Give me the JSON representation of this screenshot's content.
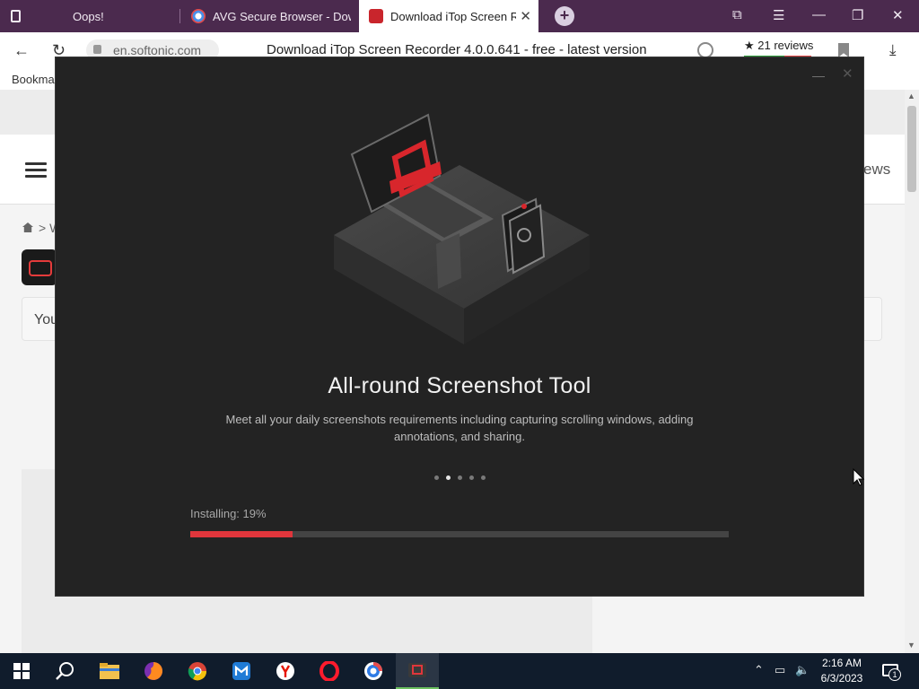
{
  "browser": {
    "tabs": [
      {
        "label": "Oops!",
        "favicon": "page-icon"
      },
      {
        "label": "AVG Secure Browser - Dow",
        "favicon": "avg-browser-icon"
      },
      {
        "label": "Download iTop Screen R",
        "favicon": "itop-icon",
        "active": true
      }
    ],
    "new_tab": "+",
    "address": {
      "url": "en.softonic.com",
      "page_title": "Download iTop Screen Recorder 4.0.0.641 - free - latest version"
    },
    "reviews": "★ 21 reviews",
    "bookmarks_label": "Bookma"
  },
  "page": {
    "header_right": "ews",
    "breadcrumb": "> W",
    "you_text": "You"
  },
  "installer": {
    "title": "All-round Screenshot Tool",
    "description": "Meet all your daily screenshots requirements including capturing scrolling windows, adding annotations, and sharing.",
    "progress_label": "Installing: 19%",
    "progress": 0.19,
    "slides": 5,
    "active_slide": 1,
    "accent": "#e0363c"
  },
  "taskbar": {
    "apps": [
      "windows-start",
      "search",
      "file-explorer",
      "firefox",
      "chrome",
      "maxthon",
      "yandex",
      "opera",
      "avg-browser",
      "itop-installer"
    ],
    "time": "2:16 AM",
    "date": "6/3/2023",
    "notification_count": "1"
  }
}
